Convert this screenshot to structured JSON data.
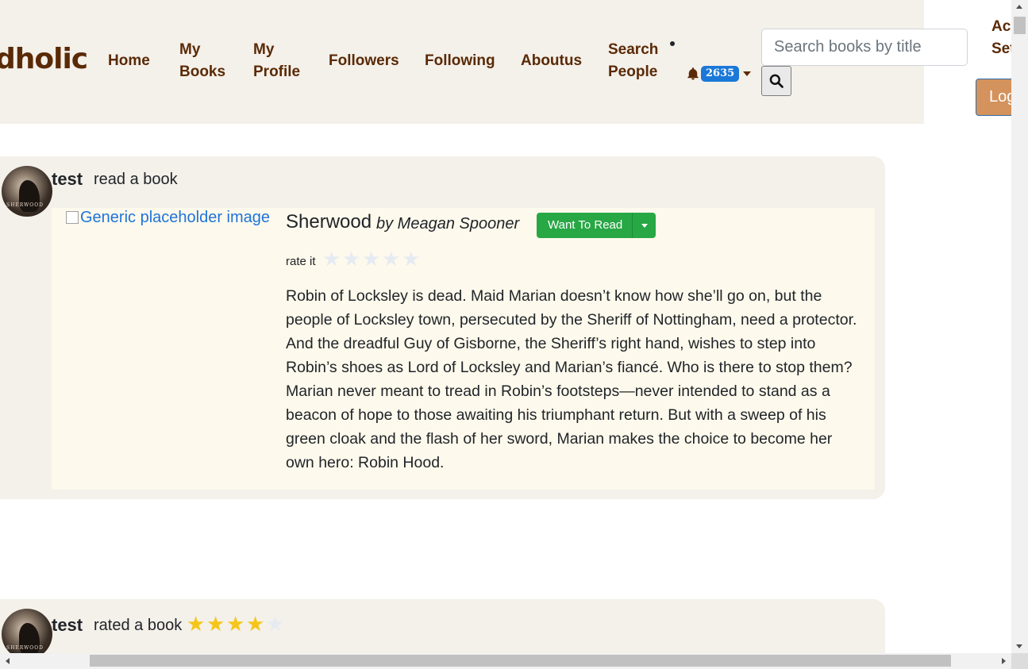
{
  "navbar": {
    "brand": "dholic",
    "links": {
      "home": "Home",
      "my_books": "My Books",
      "my_profile": "My Profile",
      "followers": "Followers",
      "following": "Following",
      "aboutus": "Aboutus",
      "search_people": "Search People"
    },
    "notifications": {
      "icon": "bell-icon",
      "count": "2635"
    },
    "search": {
      "placeholder": "Search books by title",
      "button_icon": "search-icon"
    },
    "account_settings": "Acc Set",
    "logout_label": "Log"
  },
  "feed": [
    {
      "user": "test",
      "action": "read a book",
      "book": {
        "image_alt": "Generic placeholder image",
        "title": "Sherwood",
        "author": "by Meagan Spooner",
        "status_button": "Want To Read",
        "rate_label": "rate it",
        "rating": 0,
        "max_rating": 5,
        "description": "Robin of Locksley is dead. Maid Marian doesn’t know how she’ll go on, but the people of Locksley town, persecuted by the Sheriff of Nottingham, need a protector. And the dreadful Guy of Gisborne, the Sheriff’s right hand, wishes to step into Robin’s shoes as Lord of Locksley and Marian’s fiancé. Who is there to stop them? Marian never meant to tread in Robin’s footsteps—never intended to stand as a beacon of hope to those awaiting his triumphant return. But with a sweep of his green cloak and the flash of her sword, Marian makes the choice to become her own hero: Robin Hood."
      }
    },
    {
      "user": "test",
      "action": "rated a book",
      "rating": 4,
      "max_rating": 5
    }
  ],
  "colors": {
    "brand": "#5a2a06",
    "nav_bg": "#f4f0ea",
    "badge": "#1a78d8",
    "button_green": "#28a745",
    "star_full": "#f5c518",
    "star_empty": "#e6ebf2",
    "link": "#1f73da"
  }
}
